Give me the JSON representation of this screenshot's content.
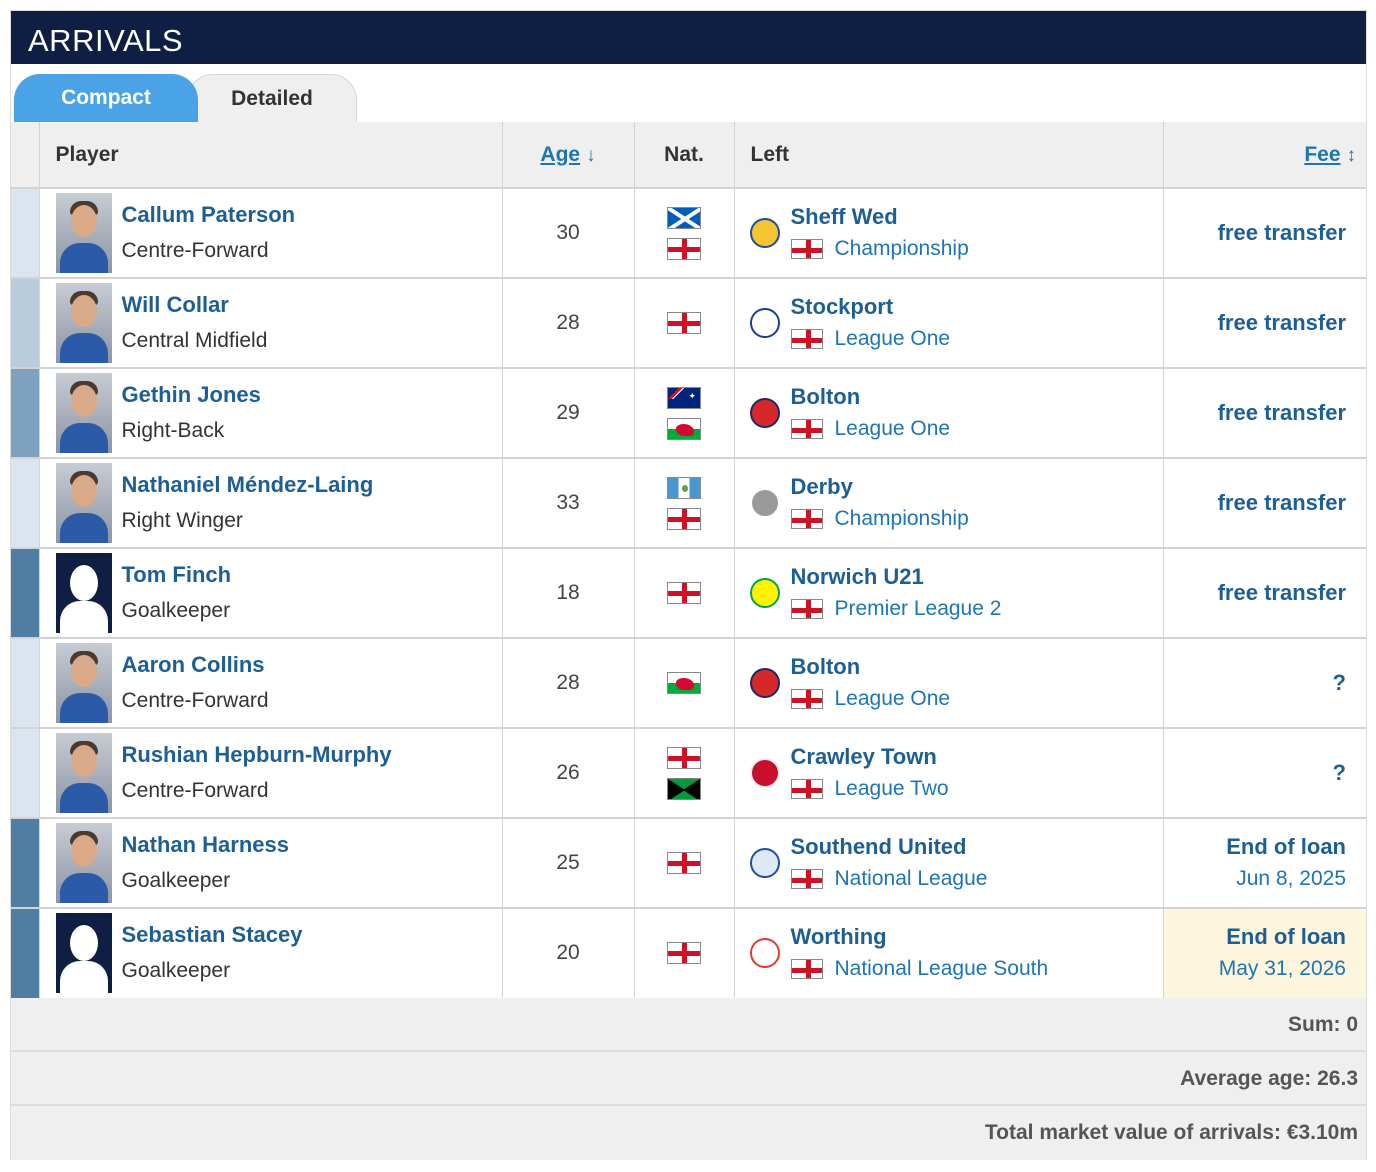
{
  "title": "ARRIVALS",
  "tabs": [
    {
      "label": "Compact",
      "active": true
    },
    {
      "label": "Detailed",
      "active": false
    }
  ],
  "columns": {
    "player": "Player",
    "age": "Age",
    "age_sort_icon": "↓",
    "nat": "Nat.",
    "left": "Left",
    "fee": "Fee",
    "fee_sort_icon": "↕"
  },
  "colors": {
    "header_bg": "#0f1f43",
    "tab_active": "#4aa3e6",
    "link": "#1d5f94",
    "highlight": "#fdf6dc"
  },
  "rows": [
    {
      "name": "Callum Paterson",
      "position": "Centre-Forward",
      "age": "30",
      "nat": [
        "scotland-flag",
        "england-flag"
      ],
      "club": "Sheff Wed",
      "crest_icon": "sheffield-wednesday-crest-icon",
      "league": "Championship",
      "fee": "free transfer",
      "fee_sub": "",
      "stripe": "#dbe5ef",
      "photo": "photo"
    },
    {
      "name": "Will Collar",
      "position": "Central Midfield",
      "age": "28",
      "nat": [
        "england-flag"
      ],
      "club": "Stockport",
      "crest_icon": "stockport-crest-icon",
      "league": "League One",
      "fee": "free transfer",
      "fee_sub": "",
      "stripe": "#b9ccdd",
      "photo": "photo"
    },
    {
      "name": "Gethin Jones",
      "position": "Right-Back",
      "age": "29",
      "nat": [
        "australia-flag",
        "wales-flag"
      ],
      "club": "Bolton",
      "crest_icon": "bolton-crest-icon",
      "league": "League One",
      "fee": "free transfer",
      "fee_sub": "",
      "stripe": "#7ea1c0",
      "photo": "photo"
    },
    {
      "name": "Nathaniel Méndez-Laing",
      "position": "Right Winger",
      "age": "33",
      "nat": [
        "guatemala-flag",
        "england-flag"
      ],
      "club": "Derby",
      "crest_icon": "derby-crest-icon",
      "league": "Championship",
      "fee": "free transfer",
      "fee_sub": "",
      "stripe": "#dbe5ef",
      "photo": "photo"
    },
    {
      "name": "Tom Finch",
      "position": "Goalkeeper",
      "age": "18",
      "nat": [
        "england-flag"
      ],
      "club": "Norwich U21",
      "crest_icon": "norwich-crest-icon",
      "league": "Premier League 2",
      "fee": "free transfer",
      "fee_sub": "",
      "stripe": "#507ea3",
      "photo": "silhouette"
    },
    {
      "name": "Aaron Collins",
      "position": "Centre-Forward",
      "age": "28",
      "nat": [
        "wales-flag"
      ],
      "club": "Bolton",
      "crest_icon": "bolton-crest-icon",
      "league": "League One",
      "fee": "?",
      "fee_sub": "",
      "stripe": "#dbe5ef",
      "photo": "photo"
    },
    {
      "name": "Rushian Hepburn-Murphy",
      "position": "Centre-Forward",
      "age": "26",
      "nat": [
        "england-flag",
        "jamaica-flag"
      ],
      "club": "Crawley Town",
      "crest_icon": "crawley-crest-icon",
      "league": "League Two",
      "fee": "?",
      "fee_sub": "",
      "stripe": "#dbe5ef",
      "photo": "photo"
    },
    {
      "name": "Nathan Harness",
      "position": "Goalkeeper",
      "age": "25",
      "nat": [
        "england-flag"
      ],
      "club": "Southend United",
      "crest_icon": "southend-crest-icon",
      "league": "National League",
      "fee": "End of loan",
      "fee_sub": "Jun 8, 2025",
      "stripe": "#507ea3",
      "photo": "photo"
    },
    {
      "name": "Sebastian Stacey",
      "position": "Goalkeeper",
      "age": "20",
      "nat": [
        "england-flag"
      ],
      "club": "Worthing",
      "crest_icon": "worthing-crest-icon",
      "league": "National League South",
      "fee": "End of loan",
      "fee_sub": "May 31, 2026",
      "stripe": "#507ea3",
      "photo": "silhouette",
      "highlight": true
    }
  ],
  "summary": {
    "sum": "Sum: 0",
    "average_age": "Average age: 26.3",
    "total_value": "Total market value of arrivals: €3.10m"
  }
}
